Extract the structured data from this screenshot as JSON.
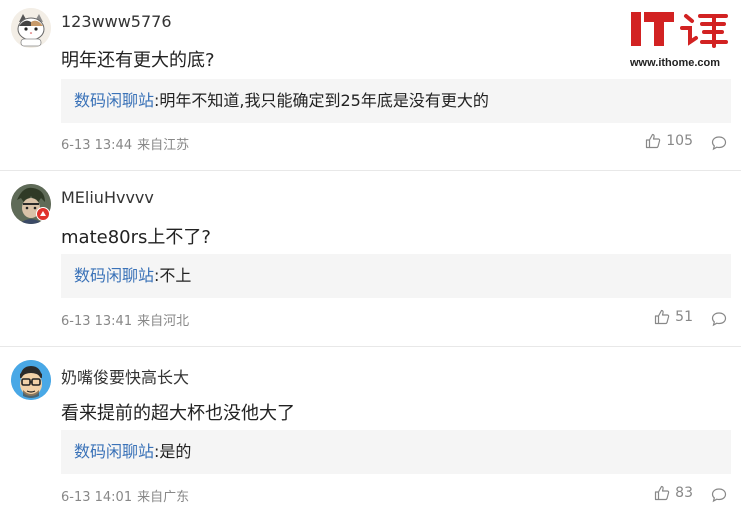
{
  "logo": {
    "brand": "IT之家",
    "url": "www.ithome.com",
    "color": "#d22222"
  },
  "comments": [
    {
      "username": "123www5776",
      "avatar_icon": "cat-avatar",
      "content": "明年还有更大的底?",
      "reply": {
        "author": "数码闲聊站",
        "separator": ":",
        "text": "明年不知道,我只能确定到25年底是没有更大的"
      },
      "time": "6-13 13:44",
      "location": "来自江苏",
      "likes": "105"
    },
    {
      "username": "MEliuHvvvv",
      "avatar_icon": "character-avatar",
      "content": "mate80rs上不了?",
      "reply": {
        "author": "数码闲聊站",
        "separator": ":",
        "text": "不上"
      },
      "time": "6-13 13:41",
      "location": "来自河北",
      "likes": "51"
    },
    {
      "username": "奶嘴俊要快高长大",
      "avatar_icon": "glasses-boy-avatar",
      "content": "看来提前的超大杯也没他大了",
      "reply": {
        "author": "数码闲聊站",
        "separator": ":",
        "text": "是的"
      },
      "time": "6-13 14:01",
      "location": "来自广东",
      "likes": "83"
    }
  ]
}
